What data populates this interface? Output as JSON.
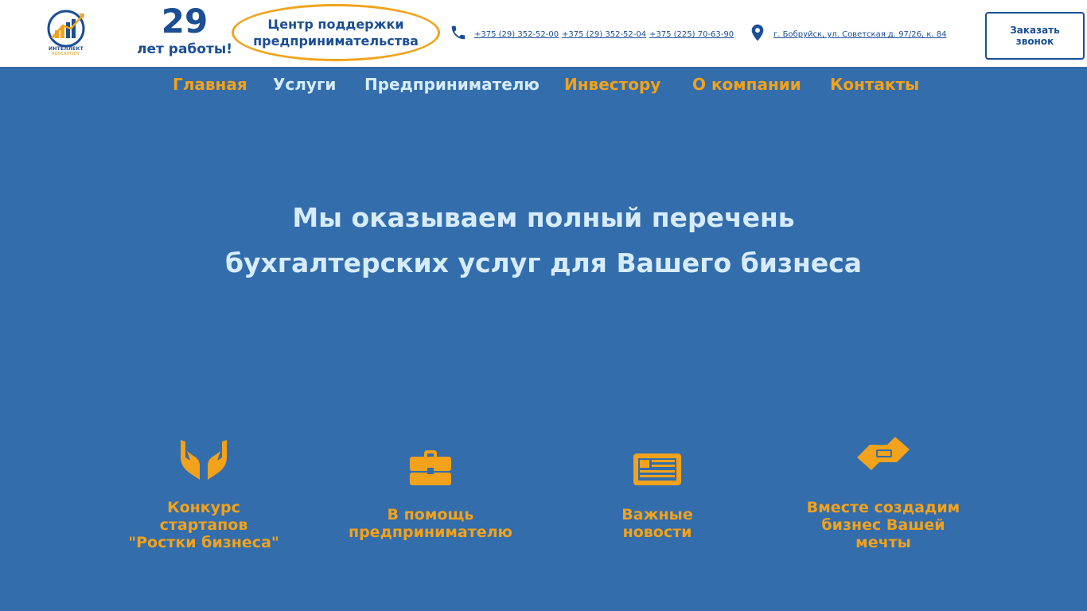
{
  "header": {
    "logo": {
      "name": "ИНТЕЛЛЕКТ",
      "subtitle": "КОНСАЛТИНГ"
    },
    "years": {
      "number": "29",
      "label": "лет работы!"
    },
    "support_center": {
      "line1": "Центр поддержки",
      "line2": "предпринимательства"
    },
    "phones": [
      "+375 (29) 352-52-00",
      "+375 (29) 352-52-04",
      "+375 (225) 70-63-90"
    ],
    "address": "г. Бобруйск, ул. Советская д. 97/26, к. 84",
    "call_button": {
      "line1": "Заказать",
      "line2": "звонок"
    }
  },
  "nav": {
    "items": [
      {
        "label": "Главная",
        "color": "#f2a21b"
      },
      {
        "label": "Услуги",
        "color": "#d7ecfb"
      },
      {
        "label": "Предпринимателю",
        "color": "#d7ecfb"
      },
      {
        "label": "Инвестору",
        "color": "#f2a21b"
      },
      {
        "label": "О компании",
        "color": "#f2a21b"
      },
      {
        "label": "Контакты",
        "color": "#f2a21b"
      }
    ]
  },
  "hero": {
    "line1": "Мы оказываем полный перечень",
    "line2": "бухгалтерских услуг для Вашего бизнеса"
  },
  "features": [
    {
      "icon": "hands-icon",
      "line1": "Конкурс",
      "line2": "стартапов",
      "line3": "\"Ростки бизнеса\""
    },
    {
      "icon": "briefcase-icon",
      "line1": "В помощь",
      "line2": "предпринимателю",
      "line3": ""
    },
    {
      "icon": "newspaper-icon",
      "line1": "Важные",
      "line2": "новости",
      "line3": ""
    },
    {
      "icon": "handshake-icon",
      "line1": "Вместе создадим",
      "line2": "бизнес Вашей",
      "line3": "мечты"
    }
  ],
  "colors": {
    "primary_bg": "#336dac",
    "accent": "#f2a21b",
    "dark_blue": "#1b4e95",
    "light_text": "#d7ecfb"
  }
}
